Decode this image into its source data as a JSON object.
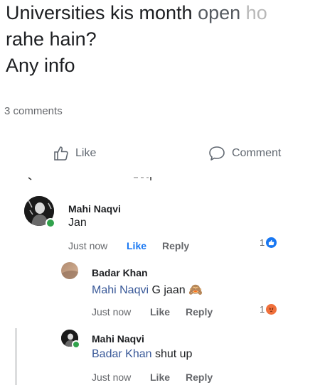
{
  "post": {
    "line1_a": "Universities kis month ",
    "line1_b": "open ",
    "line1_c": "ho",
    "line2": "rahe hain?",
    "line3": "Any info"
  },
  "stats": {
    "comments": "3 comments"
  },
  "actions": {
    "like_label": "Like",
    "comment_label": "Comment"
  },
  "comments": [
    {
      "author": "Mahi Naqvi",
      "text": "Jan",
      "time": "Just now",
      "like_label": "Like",
      "reply_label": "Reply",
      "reaction_count": "1",
      "reaction": "like-reaction-icon",
      "online": true
    },
    {
      "author": "Badar Khan",
      "mention": "Mahi Naqvi",
      "text": "G jaan",
      "emoji": "🙈",
      "time": "Just now",
      "like_label": "Like",
      "reply_label": "Reply",
      "reaction_count": "1",
      "reaction": "angry-reaction-icon"
    },
    {
      "author": "Mahi Naqvi",
      "mention": "Badar Khan",
      "text": "shut up",
      "time": "Just now",
      "like_label": "Like",
      "reply_label": "Reply"
    }
  ],
  "colors": {
    "link_blue": "#385898",
    "like_active": "#1877f2",
    "meta_gray": "#65676b",
    "online_green": "#31a24c",
    "angry_orange": "#f0703b"
  }
}
